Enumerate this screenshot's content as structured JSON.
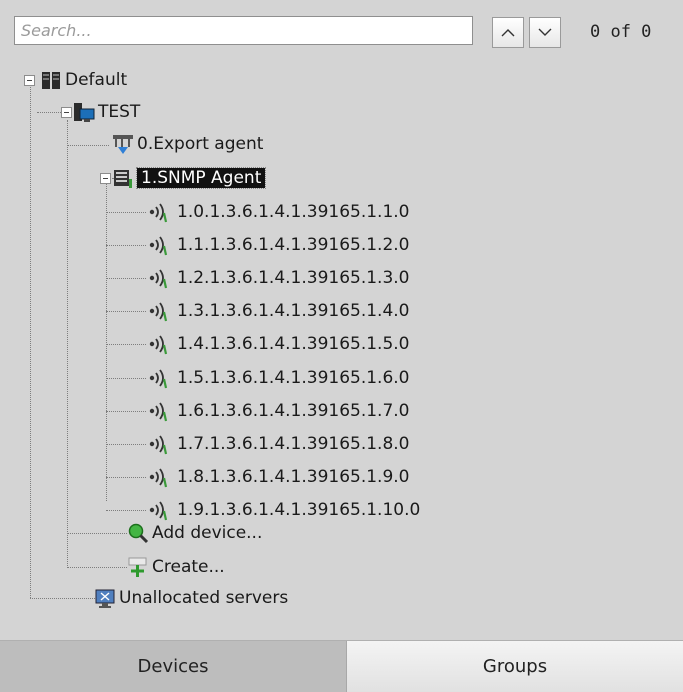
{
  "search": {
    "placeholder": "Search...",
    "value": ""
  },
  "nav": {
    "counter": "0 of 0"
  },
  "tree": {
    "root_label": "Default",
    "server_label": "TEST",
    "export_agent_label": "0.Export agent",
    "snmp_agent_label": "1.SNMP Agent",
    "oids": [
      "1.0.1.3.6.1.4.1.39165.1.1.0",
      "1.1.1.3.6.1.4.1.39165.1.2.0",
      "1.2.1.3.6.1.4.1.39165.1.3.0",
      "1.3.1.3.6.1.4.1.39165.1.4.0",
      "1.4.1.3.6.1.4.1.39165.1.5.0",
      "1.5.1.3.6.1.4.1.39165.1.6.0",
      "1.6.1.3.6.1.4.1.39165.1.7.0",
      "1.7.1.3.6.1.4.1.39165.1.8.0",
      "1.8.1.3.6.1.4.1.39165.1.9.0",
      "1.9.1.3.6.1.4.1.39165.1.10.0"
    ],
    "add_device_label": "Add device...",
    "create_label": "Create...",
    "unallocated_label": "Unallocated servers"
  },
  "tabs": {
    "devices": "Devices",
    "groups": "Groups"
  },
  "colors": {
    "background": "#d4d4d4",
    "selection": "#111111",
    "signal_green": "#3a9a3a"
  }
}
